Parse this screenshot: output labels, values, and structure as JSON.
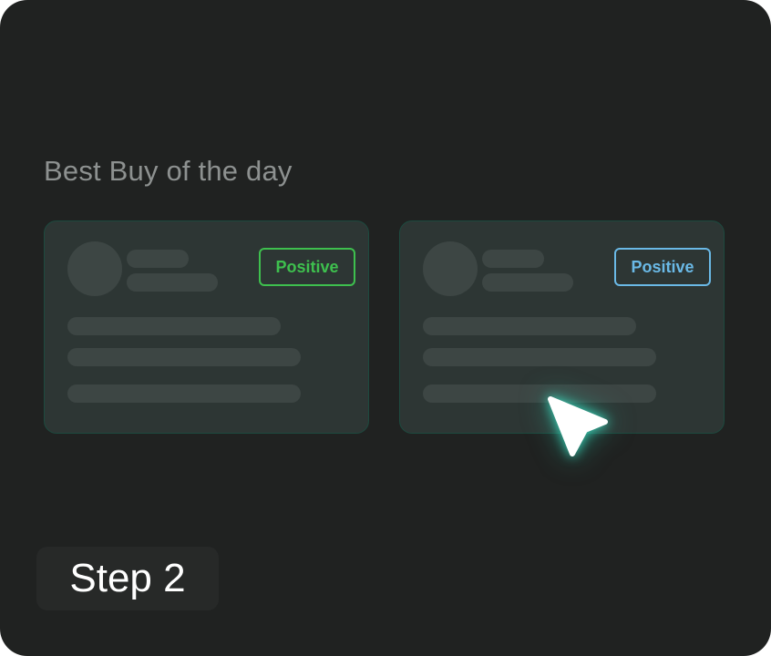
{
  "section": {
    "title": "Best Buy of the day"
  },
  "cards": [
    {
      "badge_label": "Positive",
      "badge_color": "#3ec04e"
    },
    {
      "badge_label": "Positive",
      "badge_color": "#6ab9e6"
    }
  ],
  "step": {
    "label": "Step 2"
  },
  "colors": {
    "background": "#202221",
    "card": "#2d3634",
    "card_border": "#1d4a3f",
    "placeholder": "#3d4644",
    "cursor_glow": "#3ce6c8"
  },
  "icons": {
    "cursor": "pointer-cursor-icon"
  }
}
